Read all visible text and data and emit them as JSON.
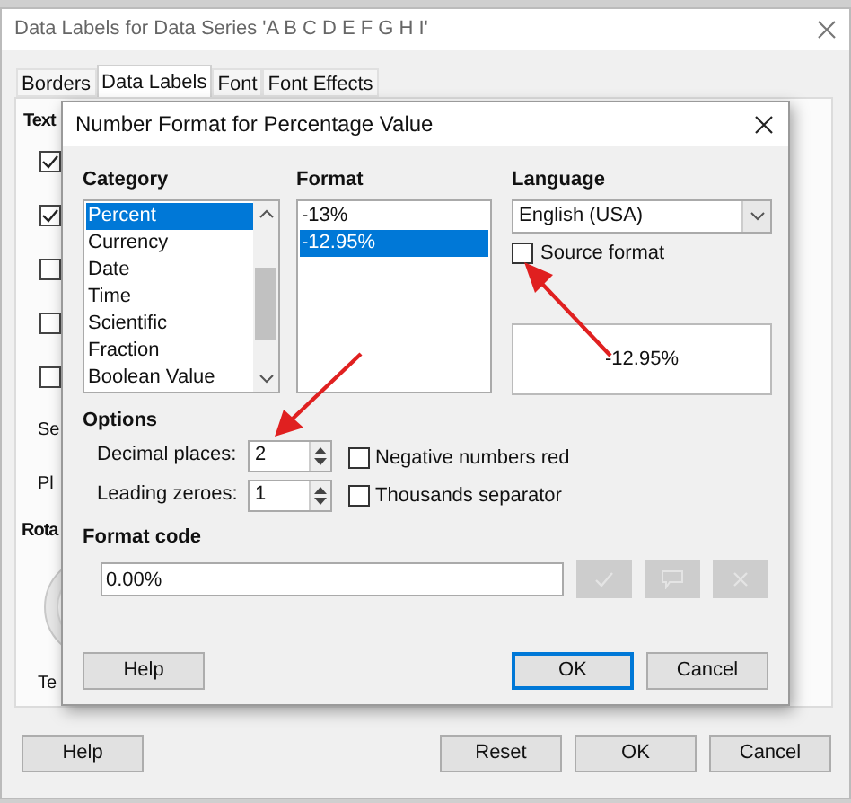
{
  "window": {
    "title": "Data Labels for Data Series 'A B C D E F G H I'"
  },
  "tabs": [
    {
      "label": "Borders",
      "selected": false
    },
    {
      "label": "Data Labels",
      "selected": true
    },
    {
      "label": "Font",
      "selected": false
    },
    {
      "label": "Font Effects",
      "selected": false
    }
  ],
  "panel": {
    "heading": "Text",
    "checkboxes": [
      {
        "checked": true
      },
      {
        "checked": true
      },
      {
        "checked": false
      },
      {
        "checked": false
      },
      {
        "checked": false
      }
    ],
    "labels": [
      "Se",
      "Pl"
    ],
    "rotation_heading": "Rota",
    "rotation_label": "Te"
  },
  "buttons": [
    {
      "label": "Help",
      "default": false
    },
    {
      "label": "Reset",
      "default": false
    },
    {
      "label": "OK",
      "default": false
    },
    {
      "label": "Cancel",
      "default": false
    }
  ],
  "dialog": {
    "title": "Number Format for Percentage Value",
    "category": {
      "label": "Category",
      "items": [
        {
          "label": "Percent",
          "selected": true
        },
        {
          "label": "Currency",
          "selected": false
        },
        {
          "label": "Date",
          "selected": false
        },
        {
          "label": "Time",
          "selected": false
        },
        {
          "label": "Scientific",
          "selected": false
        },
        {
          "label": "Fraction",
          "selected": false
        },
        {
          "label": "Boolean Value",
          "selected": false
        }
      ]
    },
    "format": {
      "label": "Format",
      "items": [
        {
          "label": "-13%",
          "selected": false
        },
        {
          "label": "-12.95%",
          "selected": true
        }
      ]
    },
    "language": {
      "label": "Language",
      "value": "English (USA)"
    },
    "source_format": {
      "label": "Source format",
      "checked": false
    },
    "preview": "-12.95%",
    "options": {
      "label": "Options",
      "spinners": [
        {
          "label": "Decimal places:",
          "value": "2"
        },
        {
          "label": "Leading zeroes:",
          "value": "1"
        }
      ],
      "checkboxes": [
        {
          "label": "Negative numbers red",
          "checked": false
        },
        {
          "label": "Thousands separator",
          "checked": false
        }
      ]
    },
    "format_code": {
      "label": "Format code",
      "value": "0.00%"
    },
    "buttons": [
      {
        "label": "Help",
        "default": false
      },
      {
        "label": "OK",
        "default": true
      },
      {
        "label": "Cancel",
        "default": false
      }
    ]
  }
}
